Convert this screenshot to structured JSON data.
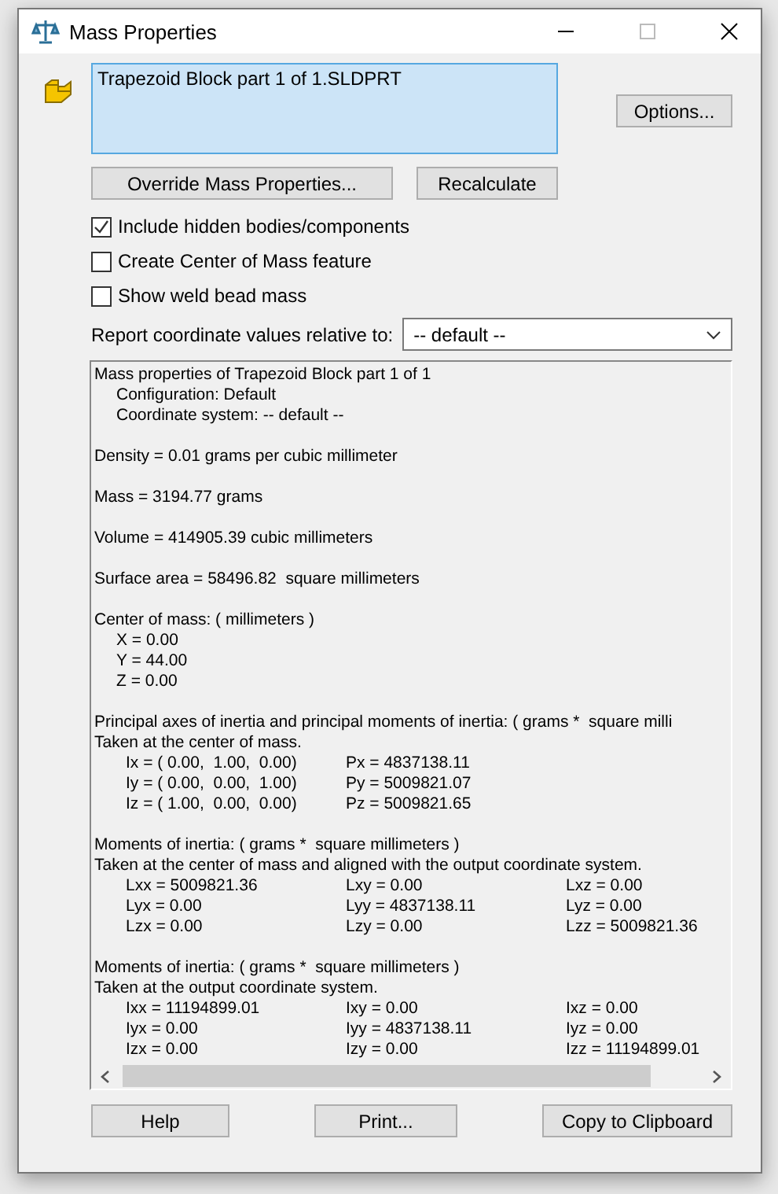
{
  "window": {
    "title": "Mass Properties"
  },
  "selection_list": {
    "items": [
      "Trapezoid Block part 1 of 1.SLDPRT"
    ]
  },
  "buttons_top": {
    "override": "Override Mass Properties...",
    "recalculate": "Recalculate",
    "options": "Options..."
  },
  "checkboxes": [
    {
      "label": "Include hidden bodies/components",
      "checked": true
    },
    {
      "label": "Create Center of Mass feature",
      "checked": false
    },
    {
      "label": "Show weld bead mass",
      "checked": false
    }
  ],
  "coordinate_select": {
    "label": "Report coordinate values relative to:",
    "value": "-- default --"
  },
  "report": {
    "blocks": [
      [
        {
          "kind": "line",
          "text": "Mass properties of Trapezoid Block part 1 of 1"
        },
        {
          "kind": "sub",
          "text": "Configuration: Default"
        },
        {
          "kind": "sub",
          "text": "Coordinate system: -- default --"
        }
      ],
      [
        {
          "kind": "line",
          "text": "Density = 0.01 grams per cubic millimeter"
        }
      ],
      [
        {
          "kind": "line",
          "text": "Mass = 3194.77 grams"
        }
      ],
      [
        {
          "kind": "line",
          "text": "Volume = 414905.39 cubic millimeters"
        }
      ],
      [
        {
          "kind": "line",
          "text": "Surface area = 58496.82  square millimeters"
        }
      ],
      [
        {
          "kind": "line",
          "text": "Center of mass: ( millimeters )"
        },
        {
          "kind": "sub",
          "text": "X = 0.00"
        },
        {
          "kind": "sub",
          "text": "Y = 44.00"
        },
        {
          "kind": "sub",
          "text": "Z = 0.00"
        }
      ],
      [
        {
          "kind": "line",
          "text": "Principal axes of inertia and principal moments of inertia: ( grams *  square milli"
        },
        {
          "kind": "line",
          "text": "Taken at the center of mass."
        },
        {
          "kind": "grid",
          "cells": [
            "Ix = ( 0.00,  1.00,  0.00)",
            "Px = 4837138.11"
          ]
        },
        {
          "kind": "grid",
          "cells": [
            "Iy = ( 0.00,  0.00,  1.00)",
            "Py = 5009821.07"
          ]
        },
        {
          "kind": "grid",
          "cells": [
            "Iz = ( 1.00,  0.00,  0.00)",
            "Pz = 5009821.65"
          ]
        }
      ],
      [
        {
          "kind": "line",
          "text": "Moments of inertia: ( grams *  square millimeters )"
        },
        {
          "kind": "line",
          "text": "Taken at the center of mass and aligned with the output coordinate system."
        },
        {
          "kind": "grid",
          "cells": [
            "Lxx = 5009821.36",
            "Lxy = 0.00",
            "Lxz = 0.00"
          ]
        },
        {
          "kind": "grid",
          "cells": [
            "Lyx = 0.00",
            "Lyy = 4837138.11",
            "Lyz = 0.00"
          ]
        },
        {
          "kind": "grid",
          "cells": [
            "Lzx = 0.00",
            "Lzy = 0.00",
            "Lzz = 5009821.36"
          ]
        }
      ],
      [
        {
          "kind": "line",
          "text": "Moments of inertia: ( grams *  square millimeters )"
        },
        {
          "kind": "line",
          "text": "Taken at the output coordinate system."
        },
        {
          "kind": "grid",
          "cells": [
            "Ixx = 11194899.01",
            "Ixy = 0.00",
            "Ixz = 0.00"
          ]
        },
        {
          "kind": "grid",
          "cells": [
            "Iyx = 0.00",
            "Iyy = 4837138.11",
            "Iyz = 0.00"
          ]
        },
        {
          "kind": "grid",
          "cells": [
            "Izx = 0.00",
            "Izy = 0.00",
            "Izz = 11194899.01"
          ]
        }
      ]
    ]
  },
  "buttons_bottom": [
    "Help",
    "Print...",
    "Copy to Clipboard"
  ]
}
